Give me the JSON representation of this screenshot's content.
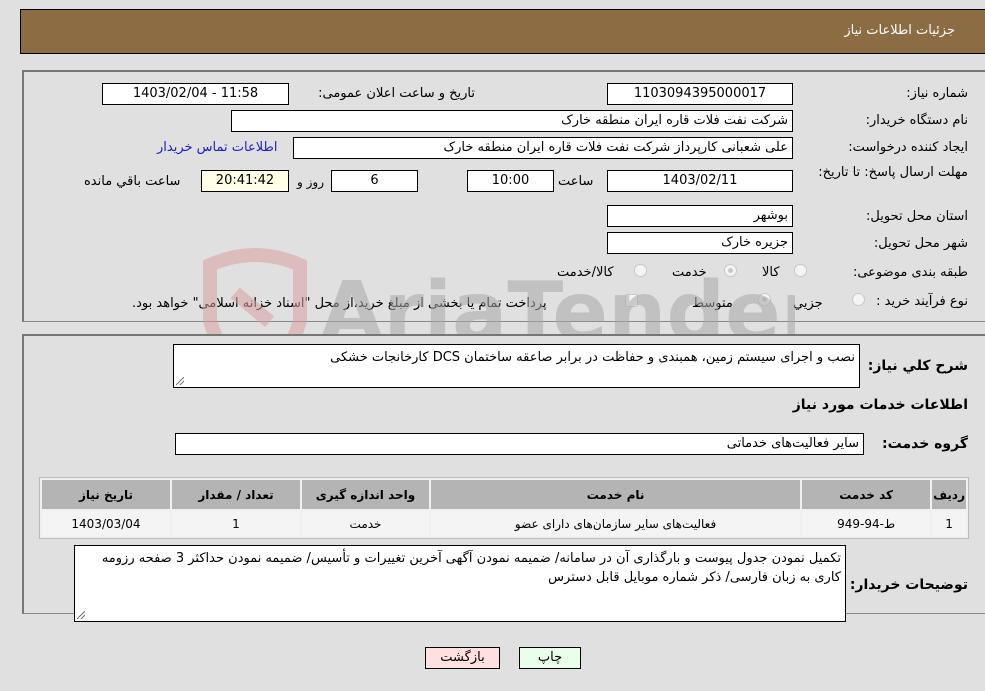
{
  "header": {
    "title": "جزئیات اطلاعات نیاز"
  },
  "form": {
    "need_number": {
      "label": "شماره نیاز:",
      "value": "1103094395000017"
    },
    "announce_datetime": {
      "label": "تاریخ و ساعت اعلان عمومی:",
      "value": "1403/02/04 - 11:58"
    },
    "buyer_org": {
      "label": "نام دستگاه خریدار:",
      "value": "شرکت نفت فلات قاره ایران منطقه خارک"
    },
    "requester": {
      "label": "ایجاد کننده درخواست:",
      "value": "علی شعبانی کارپرداز شرکت نفت فلات قاره ایران منطقه خارک"
    },
    "buyer_contact_link": "اطلاعات تماس خریدار",
    "deadline": {
      "label": "مهلت ارسال پاسخ: تا تاریخ:",
      "date": "1403/02/11",
      "time_label": "ساعت",
      "time": "10:00",
      "days": "6",
      "days_label": "روز و",
      "remaining": "20:41:42",
      "remaining_label": "ساعت باقي مانده"
    },
    "province": {
      "label": "استان محل تحویل:",
      "value": "بوشهر"
    },
    "city": {
      "label": "شهر محل تحویل:",
      "value": "جزیره خارک"
    },
    "category": {
      "label": "طبقه بندی موضوعی:",
      "options": [
        "کالا",
        "خدمت",
        "کالا/خدمت"
      ],
      "selected": "خدمت"
    },
    "purchase_type": {
      "label": "نوع فرآیند خرید :",
      "options": [
        "جزيي",
        "متوسط"
      ],
      "selected": "متوسط",
      "treasury_checkbox_label": "پرداخت تمام یا بخشی از مبلغ خرید،از محل \"اسناد خزانه اسلامی\" خواهد بود.",
      "treasury_checked": false
    }
  },
  "details": {
    "description_label": "شرح کلي نیاز:",
    "description": "نصب و اجرای سیستم زمین، همبندی و حفاظت در برابر صاعقه ساختمان DCS کارخانجات خشکی",
    "services_heading": "اطلاعات خدمات مورد نیاز",
    "service_group_label": "گروه خدمت:",
    "service_group": "سایر فعالیت‌های خدماتی",
    "table": {
      "headers": [
        "ردیف",
        "کد خدمت",
        "نام خدمت",
        "واحد اندازه گیری",
        "تعداد / مقدار",
        "تاریخ نیاز"
      ],
      "rows": [
        [
          "1",
          "ط-94-949",
          "فعالیت‌های سایر سازمان‌های دارای عضو",
          "خدمت",
          "1",
          "1403/03/04"
        ]
      ]
    },
    "buyer_notes_label": "توضیحات خریدار:",
    "buyer_notes": "تکمیل نمودن جدول پیوست و بارگذاری آن در سامانه/ ضمیمه نمودن آگهی آخرین تغییرات و تأسیس/ ضمیمه نمودن حداکثر 3 صفحه رزومه کاری به زبان فارسی/ ذکر شماره موبایل قابل دسترس"
  },
  "buttons": {
    "print": "چاپ",
    "back": "بازگشت"
  },
  "watermark": {
    "text": "AriaTender.net"
  },
  "colors": {
    "header": "#8c6d43",
    "link": "#1d1dc8",
    "print_bg": "#eaffea",
    "back_bg": "#ffe0e0",
    "remaining_bg": "#ffffe8"
  }
}
